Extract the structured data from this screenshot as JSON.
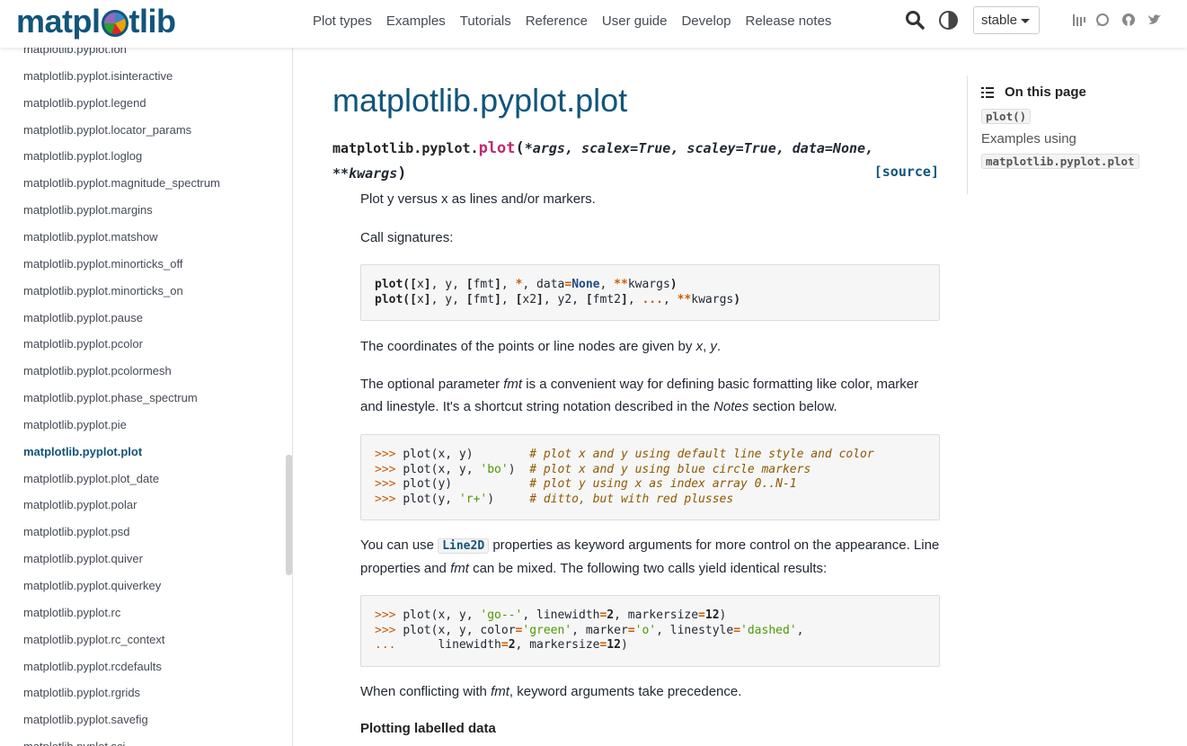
{
  "header": {
    "logo_text_pre": "matpl",
    "logo_text_post": "tlib",
    "nav": [
      "Plot types",
      "Examples",
      "Tutorials",
      "Reference",
      "User guide",
      "Develop",
      "Release notes"
    ],
    "version": "stable",
    "icons": [
      "search-icon",
      "theme-toggle-icon",
      "gitter-icon",
      "discourse-icon",
      "github-icon",
      "twitter-icon"
    ]
  },
  "sidebar": {
    "items": [
      "matplotlib.pyplot.ion",
      "matplotlib.pyplot.isinteractive",
      "matplotlib.pyplot.legend",
      "matplotlib.pyplot.locator_params",
      "matplotlib.pyplot.loglog",
      "matplotlib.pyplot.magnitude_spectrum",
      "matplotlib.pyplot.margins",
      "matplotlib.pyplot.matshow",
      "matplotlib.pyplot.minorticks_off",
      "matplotlib.pyplot.minorticks_on",
      "matplotlib.pyplot.pause",
      "matplotlib.pyplot.pcolor",
      "matplotlib.pyplot.pcolormesh",
      "matplotlib.pyplot.phase_spectrum",
      "matplotlib.pyplot.pie",
      "matplotlib.pyplot.plot",
      "matplotlib.pyplot.plot_date",
      "matplotlib.pyplot.polar",
      "matplotlib.pyplot.psd",
      "matplotlib.pyplot.quiver",
      "matplotlib.pyplot.quiverkey",
      "matplotlib.pyplot.rc",
      "matplotlib.pyplot.rc_context",
      "matplotlib.pyplot.rcdefaults",
      "matplotlib.pyplot.rgrids",
      "matplotlib.pyplot.savefig",
      "matplotlib.pyplot.sci"
    ],
    "active": "matplotlib.pyplot.plot"
  },
  "main": {
    "title": "matplotlib.pyplot.plot",
    "signature": {
      "module": "matplotlib.pyplot.",
      "function": "plot",
      "params_line1": "*args, scalex=True, scaley=True, data=None,",
      "params_line2": "**kwargs",
      "source_link": "[source]"
    },
    "summary": "Plot y versus x as lines and/or markers.",
    "call_sig_label": "Call signatures:",
    "para_coords_pre": "The coordinates of the points or line nodes are given by ",
    "para_coords_x": "x",
    "para_coords_sep": ", ",
    "para_coords_y": "y",
    "para_coords_end": ".",
    "para_fmt_1": "The optional parameter ",
    "para_fmt_em": "fmt",
    "para_fmt_2": " is a convenient way for defining basic formatting like color, marker and linestyle. It's a shortcut string notation described in the ",
    "para_fmt_notes": "Notes",
    "para_fmt_3": " section below.",
    "para_line2d_1": "You can use ",
    "para_line2d_code": "Line2D",
    "para_line2d_2": " properties as keyword arguments for more control on the appearance. Line properties and ",
    "para_line2d_em": "fmt",
    "para_line2d_3": " can be mixed. The following two calls yield identical results:",
    "para_conflict_1": "When conflicting with ",
    "para_conflict_em": "fmt",
    "para_conflict_2": ", keyword arguments take precedence.",
    "subheading": "Plotting labelled data"
  },
  "toc": {
    "title": "On this page",
    "item1": "plot()",
    "item2_text": "Examples using",
    "item2_code": "matplotlib.pyplot.plot"
  }
}
